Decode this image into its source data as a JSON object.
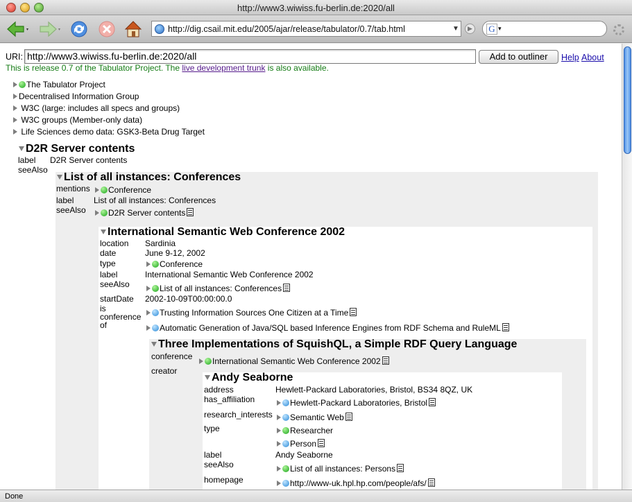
{
  "window": {
    "title": "http://www3.wiwiss.fu-berlin.de:2020/all"
  },
  "toolbar": {
    "address": "http://dig.csail.mit.edu/2005/ajar/release/tabulator/0.7/tab.html",
    "search_placeholder": "",
    "search_engine_glyph": "G"
  },
  "page": {
    "uri_label": "URI:",
    "uri_value": "http://www3.wiwiss.fu-berlin.de:2020/all",
    "add_button": "Add to outliner",
    "help_link": "Help",
    "about_link": "About",
    "release_prefix": "This is release 0.7 of the Tabulator Project. The ",
    "release_link": "live development trunk",
    "release_suffix": " is also available.",
    "top_items": [
      "The Tabulator Project",
      "Decentralised Information Group",
      "W3C (large: includes all specs and groups)",
      "W3C groups (Member-only data)",
      "Life Sciences demo data: GSK3-Beta Drug Target"
    ],
    "d2r": {
      "title": "D2R Server contents",
      "label_key": "label",
      "label_val": "D2R Server contents",
      "seealso_key": "seeAlso"
    },
    "conferences": {
      "title": "List of all instances: Conferences",
      "mentions_key": "mentions",
      "mentions_val": "Conference",
      "label_key": "label",
      "label_val": "List of all instances: Conferences",
      "seealso_key": "seeAlso",
      "seealso_val": "D2R Server contents"
    },
    "iswc": {
      "title": "International Semantic Web Conference 2002",
      "location_key": "location",
      "location_val": "Sardinia",
      "date_key": "date",
      "date_val": "June 9-12, 2002",
      "type_key": "type",
      "type_val": "Conference",
      "label_key": "label",
      "label_val": "International Semantic Web Conference 2002",
      "seealso_key": "seeAlso",
      "seealso_val": "List of all instances: Conferences",
      "startdate_key": "startDate",
      "startdate_val": "2002-10-09T00:00:00.0",
      "isconf_key_1": "is",
      "isconf_key_2": "conference",
      "isconf_key_3": "of",
      "isconf_val_1": "Trusting Information Sources One Citizen at a Time",
      "isconf_val_2": "Automatic Generation of Java/SQL based Inference Engines from RDF Schema and RuleML"
    },
    "squish": {
      "title": "Three Implementations of SquishQL, a Simple RDF Query Language",
      "conference_key": "conference",
      "conference_val": "International Semantic Web Conference 2002",
      "creator_key": "creator"
    },
    "andy": {
      "title": "Andy Seaborne",
      "address_key": "address",
      "address_val": "Hewlett-Packard Laboratories, Bristol, BS34 8QZ, UK",
      "affil_key": "has_affiliation",
      "affil_val": "Hewlett-Packard Laboratories, Bristol",
      "research_key": "research_interests",
      "research_val": "Semantic Web",
      "type_key": "type",
      "type_val_1": "Researcher",
      "type_val_2": "Person",
      "label_key": "label",
      "label_val": "Andy Seaborne",
      "seealso_key": "seeAlso",
      "seealso_val": "List of all instances: Persons",
      "homepage_key": "homepage",
      "homepage_val": "http://www-uk.hpl.hp.com/people/afs/"
    }
  },
  "status": {
    "text": "Done"
  }
}
